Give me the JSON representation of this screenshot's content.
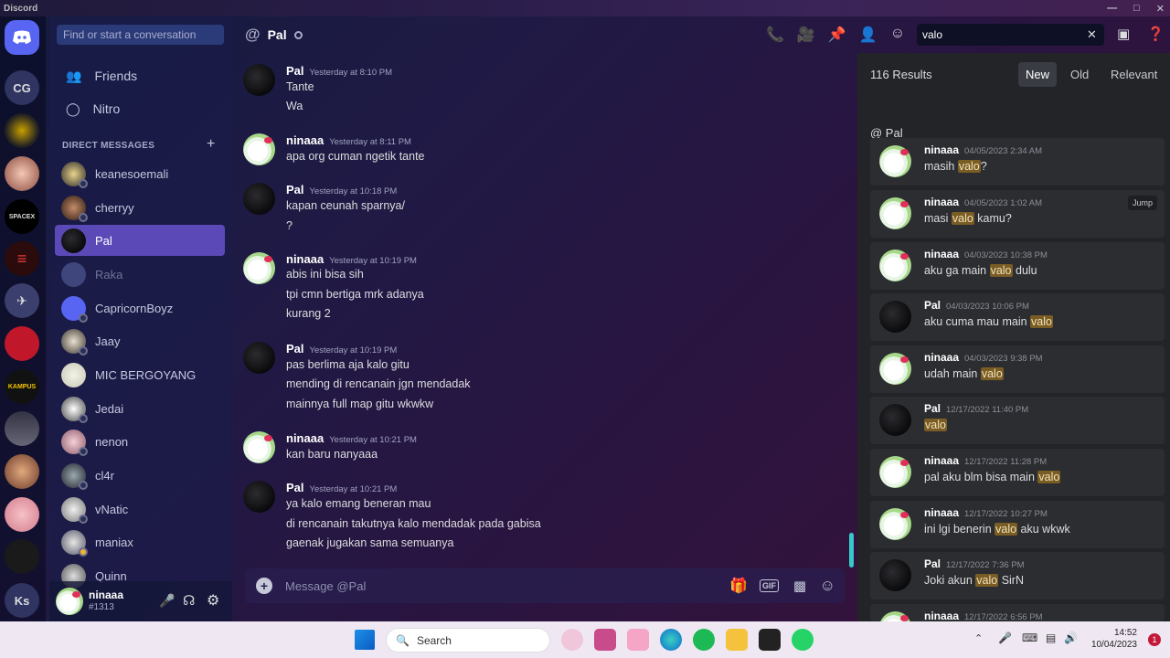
{
  "window": {
    "title": "Discord"
  },
  "rail": {
    "servers": [
      "CG",
      "Ks"
    ]
  },
  "dms": {
    "search_placeholder": "Find or start a conversation",
    "friends": "Friends",
    "nitro": "Nitro",
    "header": "DIRECT MESSAGES",
    "items": [
      "keanesoemali",
      "cherryy",
      "Pal",
      "Raka",
      "CapricornBoyz",
      "Jaay",
      "MIC BERGOYANG",
      "Jedai",
      "nenon",
      "cl4r",
      "vNatic",
      "maniax",
      "Quinn"
    ]
  },
  "user": {
    "name": "ninaaa",
    "tag": "#1313"
  },
  "chat": {
    "title": "Pal",
    "messages": [
      {
        "name": "Pal",
        "time": "Yesterday at 8:10 PM",
        "lines": [
          "Tante",
          "Wa"
        ]
      },
      {
        "name": "ninaaa",
        "time": "Yesterday at 8:11 PM",
        "lines": [
          "apa org cuman ngetik tante"
        ]
      },
      {
        "name": "Pal",
        "time": "Yesterday at 10:18 PM",
        "lines": [
          "kapan ceunah sparnya/",
          "?"
        ]
      },
      {
        "name": "ninaaa",
        "time": "Yesterday at 10:19 PM",
        "lines": [
          "abis ini bisa sih",
          "tpi cmn bertiga mrk adanya",
          "kurang 2"
        ]
      },
      {
        "name": "Pal",
        "time": "Yesterday at 10:19 PM",
        "lines": [
          "pas berlima aja kalo gitu",
          "mending di rencanain jgn mendadak",
          "mainnya full map gitu wkwkw"
        ]
      },
      {
        "name": "ninaaa",
        "time": "Yesterday at 10:21 PM",
        "lines": [
          "kan baru nanyaaa"
        ]
      },
      {
        "name": "Pal",
        "time": "Yesterday at 10:21 PM",
        "lines": [
          "ya kalo emang beneran mau",
          "di rencanain takutnya kalo mendadak pada gabisa",
          "gaenak jugakan sama semuanya"
        ]
      }
    ],
    "composer_placeholder": "Message @Pal"
  },
  "search": {
    "query": "valo"
  },
  "results": {
    "count": "116 Results",
    "tabs": [
      "New",
      "Old",
      "Relevant"
    ],
    "channel": "@ Pal",
    "jump": "Jump",
    "items": [
      {
        "name": "ninaaa",
        "time": "04/05/2023 2:34 AM",
        "pre": "masih ",
        "hit": "valo",
        "post": "?"
      },
      {
        "name": "ninaaa",
        "time": "04/05/2023 1:02 AM",
        "pre": "masi ",
        "hit": "valo",
        "post": " kamu?"
      },
      {
        "name": "ninaaa",
        "time": "04/03/2023 10:38 PM",
        "pre": "aku ga main ",
        "hit": "valo",
        "post": " dulu"
      },
      {
        "name": "Pal",
        "time": "04/03/2023 10:06 PM",
        "pre": "aku cuma mau main ",
        "hit": "valo",
        "post": ""
      },
      {
        "name": "ninaaa",
        "time": "04/03/2023 9:38 PM",
        "pre": "udah main ",
        "hit": "valo",
        "post": ""
      },
      {
        "name": "Pal",
        "time": "12/17/2022 11:40 PM",
        "pre": "",
        "hit": "valo",
        "post": ""
      },
      {
        "name": "ninaaa",
        "time": "12/17/2022 11:28 PM",
        "pre": "pal aku blm bisa main ",
        "hit": "valo",
        "post": ""
      },
      {
        "name": "ninaaa",
        "time": "12/17/2022 10:27 PM",
        "pre": "ini lgi benerin ",
        "hit": "valo",
        "post": " aku wkwk"
      },
      {
        "name": "Pal",
        "time": "12/17/2022 7:36 PM",
        "pre": "Joki akun ",
        "hit": "valo",
        "post": " SirN"
      },
      {
        "name": "ninaaa",
        "time": "12/17/2022 6:56 PM",
        "pre": "",
        "hit": "",
        "post": ""
      }
    ]
  },
  "taskbar": {
    "search": "Search",
    "time": "14:52",
    "date": "10/04/2023",
    "badge": "1"
  }
}
